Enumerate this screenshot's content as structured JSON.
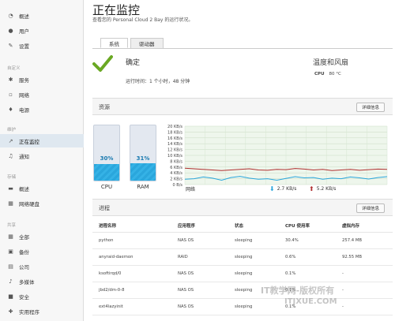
{
  "sidebar": {
    "items": [
      {
        "label": "概述",
        "icon": "dashboard-icon"
      },
      {
        "label": "用户",
        "icon": "user-icon"
      },
      {
        "label": "设置",
        "icon": "wrench-icon"
      }
    ],
    "custom_title": "自定义",
    "custom_items": [
      {
        "label": "服务",
        "icon": "gear-icon"
      },
      {
        "label": "网络",
        "icon": "network-icon"
      },
      {
        "label": "电源",
        "icon": "power-icon"
      }
    ],
    "maintenance_title": "维护",
    "maintenance_items": [
      {
        "label": "正在监控",
        "icon": "monitor-icon",
        "active": true
      },
      {
        "label": "通知",
        "icon": "bell-icon"
      }
    ],
    "storage_title": "存储",
    "storage_items": [
      {
        "label": "概述",
        "icon": "storage-overview-icon"
      },
      {
        "label": "网络硬盘",
        "icon": "network-drive-icon"
      }
    ],
    "shares_title": "共享",
    "shares_items": [
      {
        "label": "全部",
        "icon": "grid-icon"
      },
      {
        "label": "备份",
        "icon": "backup-icon"
      },
      {
        "label": "公司",
        "icon": "company-icon"
      },
      {
        "label": "多媒体",
        "icon": "music-icon"
      },
      {
        "label": "安全",
        "icon": "lock-icon"
      },
      {
        "label": "实用程序",
        "icon": "utility-icon"
      }
    ]
  },
  "header": {
    "title": "正在监控",
    "subtitle": "查看您的 Personal Cloud 2 Bay 的运行状况。"
  },
  "tabs": [
    "系统",
    "驱动器"
  ],
  "system": {
    "status": "确定",
    "uptime": "运行时间：1 个小时，48 分钟",
    "fan_title": "温度和风扇",
    "cpu_label": "CPU",
    "cpu_temp": "80 °C"
  },
  "resources": {
    "label": "资源",
    "details_button": "详细信息",
    "cpu_pct": "30%",
    "cpu_value": 0.3,
    "cpu_label": "CPU",
    "ram_pct": "31%",
    "ram_value": 0.31,
    "ram_label": "RAM",
    "network_label": "网络",
    "download": "2.7 KB/s",
    "upload": "5.2 KB/s"
  },
  "chart_data": {
    "type": "line",
    "title": "",
    "xlabel": "网络",
    "ylabel": "",
    "ylim": [
      0,
      20
    ],
    "y_ticks": [
      "0 B/s",
      "2 KB/s",
      "4 KB/s",
      "6 KB/s",
      "8 KB/s",
      "10 KB/s",
      "12 KB/s",
      "14 KB/s",
      "16 KB/s",
      "18 KB/s",
      "20 KB/s"
    ],
    "grid": true,
    "series": [
      {
        "name": "2.7 KB/s",
        "color": "#2aa6dc",
        "values": [
          1.8,
          2.0,
          2.6,
          2.2,
          1.5,
          2.4,
          2.8,
          2.2,
          1.8,
          2.0,
          1.5,
          2.1,
          2.7,
          2.3,
          2.4,
          1.8,
          2.2,
          2.0,
          2.6,
          2.3,
          1.9,
          2.4,
          2.7
        ]
      },
      {
        "name": "5.2 KB/s",
        "color": "#b03030",
        "values": [
          5.6,
          5.4,
          5.2,
          5.0,
          4.8,
          5.0,
          5.2,
          5.4,
          5.0,
          4.9,
          5.2,
          5.1,
          5.5,
          5.3,
          5.0,
          5.2,
          4.8,
          5.0,
          5.2,
          4.9,
          5.1,
          5.3,
          5.2
        ]
      }
    ]
  },
  "processes": {
    "label": "进程",
    "details_button": "详细信息",
    "columns": [
      "进程名称",
      "应用程序",
      "状态",
      "CPU 使用率",
      "虚拟内存"
    ],
    "rows": [
      [
        "python",
        "NAS OS",
        "sleeping",
        "30.4%",
        "257.4 MB"
      ],
      [
        "anyraid-daemon",
        "RAID",
        "sleeping",
        "0.6%",
        "92.55 MB"
      ],
      [
        "ksoftirqd/0",
        "NAS OS",
        "sleeping",
        "0.1%",
        "-"
      ],
      [
        "jbd2/dm-0-8",
        "NAS OS",
        "sleeping",
        "0.1%",
        "-"
      ],
      [
        "ext4lazyinit",
        "NAS OS",
        "sleeping",
        "0.1%",
        "-"
      ]
    ]
  },
  "watermark": {
    "line1": "IT教学网-版权所有",
    "line2": "ITJXUE.COM"
  },
  "colors": {
    "accent": "#2aa6dc",
    "ok_green": "#6aa823",
    "upload_red": "#b03030"
  }
}
